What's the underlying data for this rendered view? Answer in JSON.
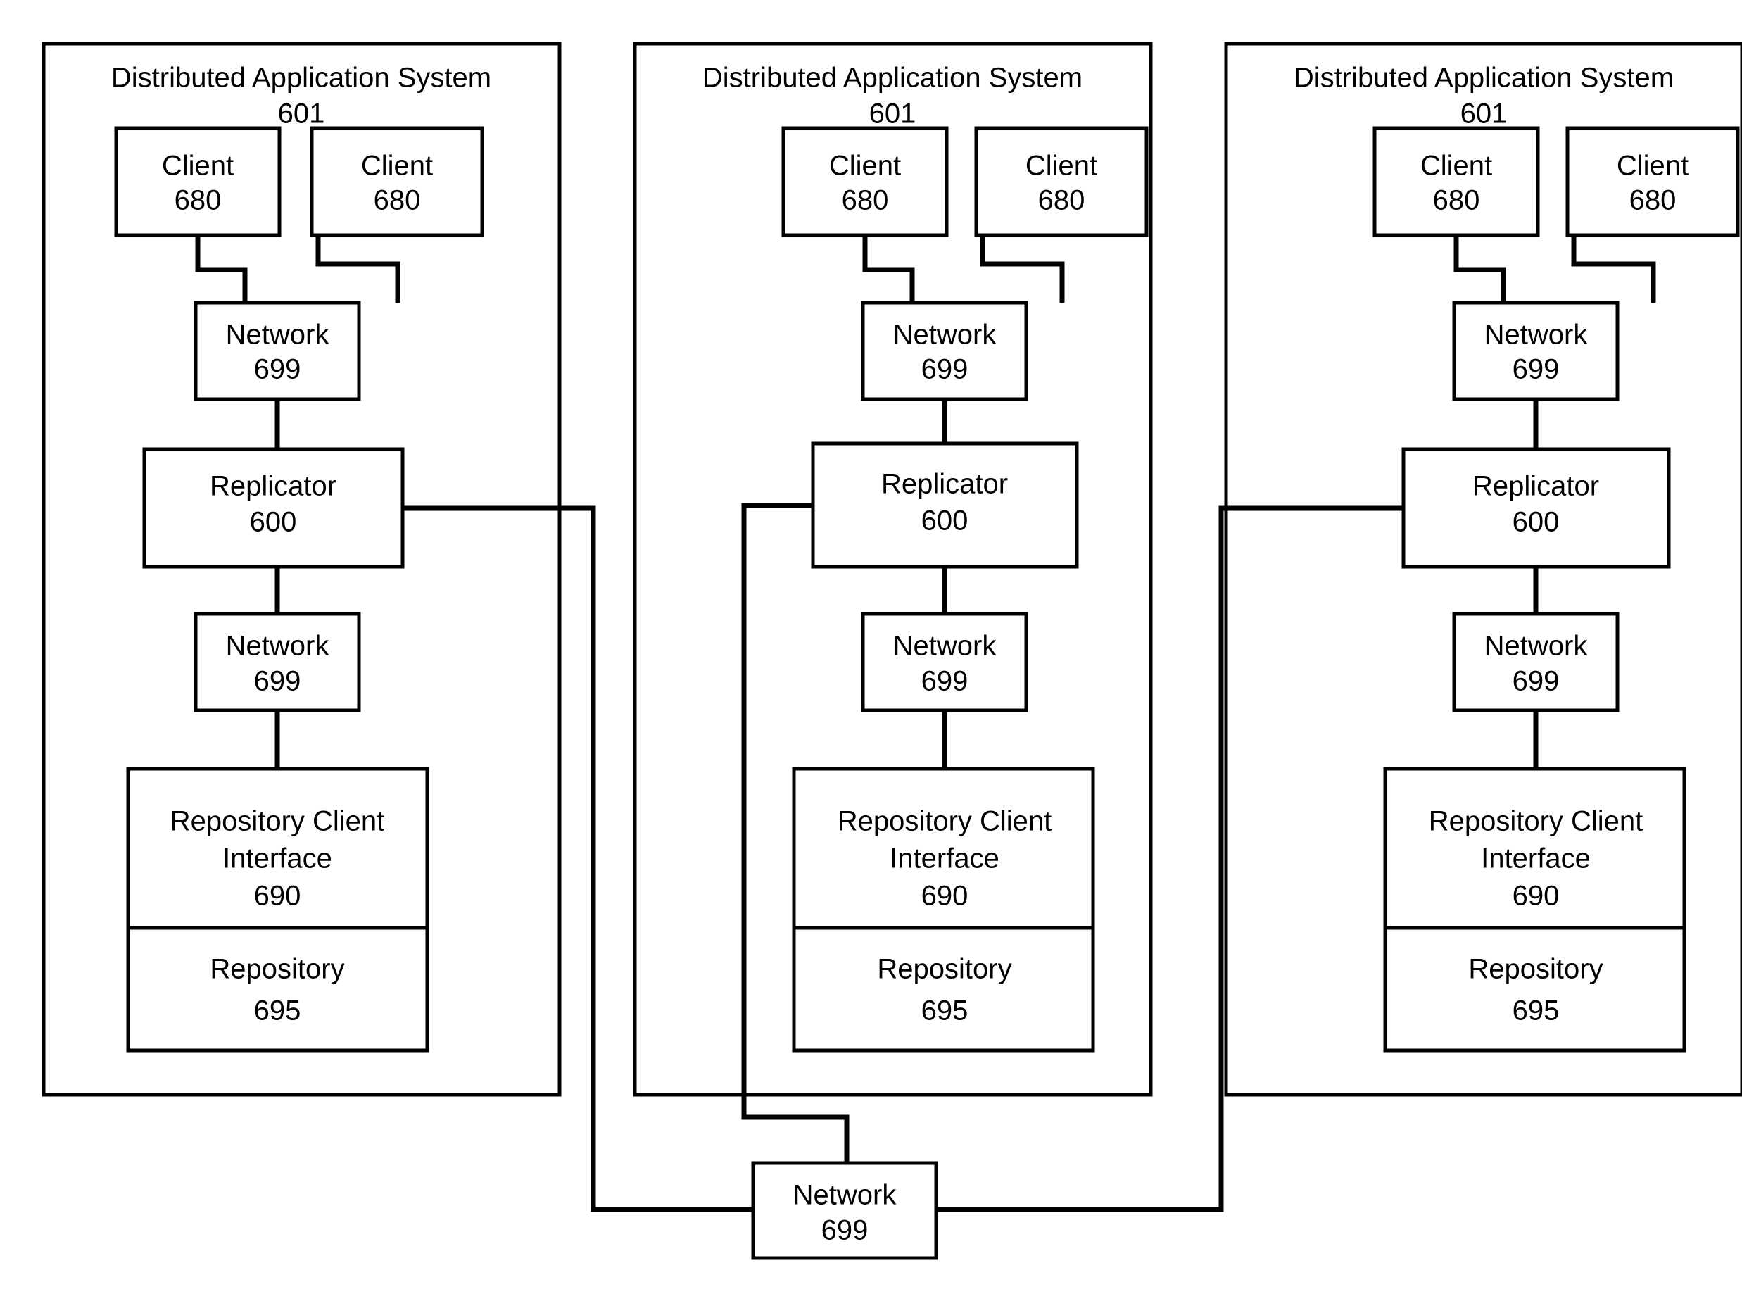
{
  "figure": {
    "domain": "diagram",
    "kind": "patent-block-diagram",
    "background_color": "#ffffff",
    "line_color": "#000000"
  },
  "labels": {
    "panel_title": "Distributed Application System",
    "panel_ref": "601",
    "client_title": "Client",
    "client_ref": "680",
    "network_title": "Network",
    "network_ref": "699",
    "replicator_title": "Replicator",
    "replicator_ref": "600",
    "repo_client_interface_line1": "Repository Client",
    "repo_client_interface_line2": "Interface",
    "repo_client_interface_ref": "690",
    "repository_title": "Repository",
    "repository_ref": "695",
    "shared_network_title": "Network",
    "shared_network_ref": "699"
  },
  "panels": [
    {
      "id": "panel-left",
      "title": "Distributed Application System",
      "ref": "601",
      "nodes": [
        {
          "id": "client-a",
          "label": "Client",
          "ref": "680"
        },
        {
          "id": "client-b",
          "label": "Client",
          "ref": "680"
        },
        {
          "id": "network-top",
          "label": "Network",
          "ref": "699"
        },
        {
          "id": "replicator",
          "label": "Replicator",
          "ref": "600"
        },
        {
          "id": "network-bottom",
          "label": "Network",
          "ref": "699"
        },
        {
          "id": "repo-client-interface",
          "label": "Repository Client Interface",
          "ref": "690"
        },
        {
          "id": "repository",
          "label": "Repository",
          "ref": "695"
        }
      ]
    },
    {
      "id": "panel-middle",
      "title": "Distributed Application System",
      "ref": "601",
      "nodes": [
        {
          "id": "client-a",
          "label": "Client",
          "ref": "680"
        },
        {
          "id": "client-b",
          "label": "Client",
          "ref": "680"
        },
        {
          "id": "network-top",
          "label": "Network",
          "ref": "699"
        },
        {
          "id": "replicator",
          "label": "Replicator",
          "ref": "600"
        },
        {
          "id": "network-bottom",
          "label": "Network",
          "ref": "699"
        },
        {
          "id": "repo-client-interface",
          "label": "Repository Client Interface",
          "ref": "690"
        },
        {
          "id": "repository",
          "label": "Repository",
          "ref": "695"
        }
      ]
    },
    {
      "id": "panel-right",
      "title": "Distributed Application System",
      "ref": "601",
      "nodes": [
        {
          "id": "client-a",
          "label": "Client",
          "ref": "680"
        },
        {
          "id": "client-b",
          "label": "Client",
          "ref": "680"
        },
        {
          "id": "network-top",
          "label": "Network",
          "ref": "699"
        },
        {
          "id": "replicator",
          "label": "Replicator",
          "ref": "600"
        },
        {
          "id": "network-bottom",
          "label": "Network",
          "ref": "699"
        },
        {
          "id": "repo-client-interface",
          "label": "Repository Client Interface",
          "ref": "690"
        },
        {
          "id": "repository",
          "label": "Repository",
          "ref": "695"
        }
      ]
    }
  ],
  "shared_network": {
    "id": "shared-network",
    "label": "Network",
    "ref": "699"
  },
  "connections": [
    {
      "from": "panel-left.client-a",
      "to": "panel-left.network-top"
    },
    {
      "from": "panel-left.client-b",
      "to": "panel-left.network-top"
    },
    {
      "from": "panel-left.network-top",
      "to": "panel-left.replicator"
    },
    {
      "from": "panel-left.replicator",
      "to": "panel-left.network-bottom"
    },
    {
      "from": "panel-left.network-bottom",
      "to": "panel-left.repo-client-interface"
    },
    {
      "from": "panel-left.replicator",
      "to": "shared-network"
    },
    {
      "from": "panel-middle.client-a",
      "to": "panel-middle.network-top"
    },
    {
      "from": "panel-middle.client-b",
      "to": "panel-middle.network-top"
    },
    {
      "from": "panel-middle.network-top",
      "to": "panel-middle.replicator"
    },
    {
      "from": "panel-middle.replicator",
      "to": "panel-middle.network-bottom"
    },
    {
      "from": "panel-middle.network-bottom",
      "to": "panel-middle.repo-client-interface"
    },
    {
      "from": "panel-middle.replicator",
      "to": "shared-network"
    },
    {
      "from": "panel-right.client-a",
      "to": "panel-right.network-top"
    },
    {
      "from": "panel-right.client-b",
      "to": "panel-right.network-top"
    },
    {
      "from": "panel-right.network-top",
      "to": "panel-right.replicator"
    },
    {
      "from": "panel-right.replicator",
      "to": "panel-right.network-bottom"
    },
    {
      "from": "panel-right.network-bottom",
      "to": "panel-right.repo-client-interface"
    },
    {
      "from": "panel-right.replicator",
      "to": "shared-network"
    }
  ]
}
